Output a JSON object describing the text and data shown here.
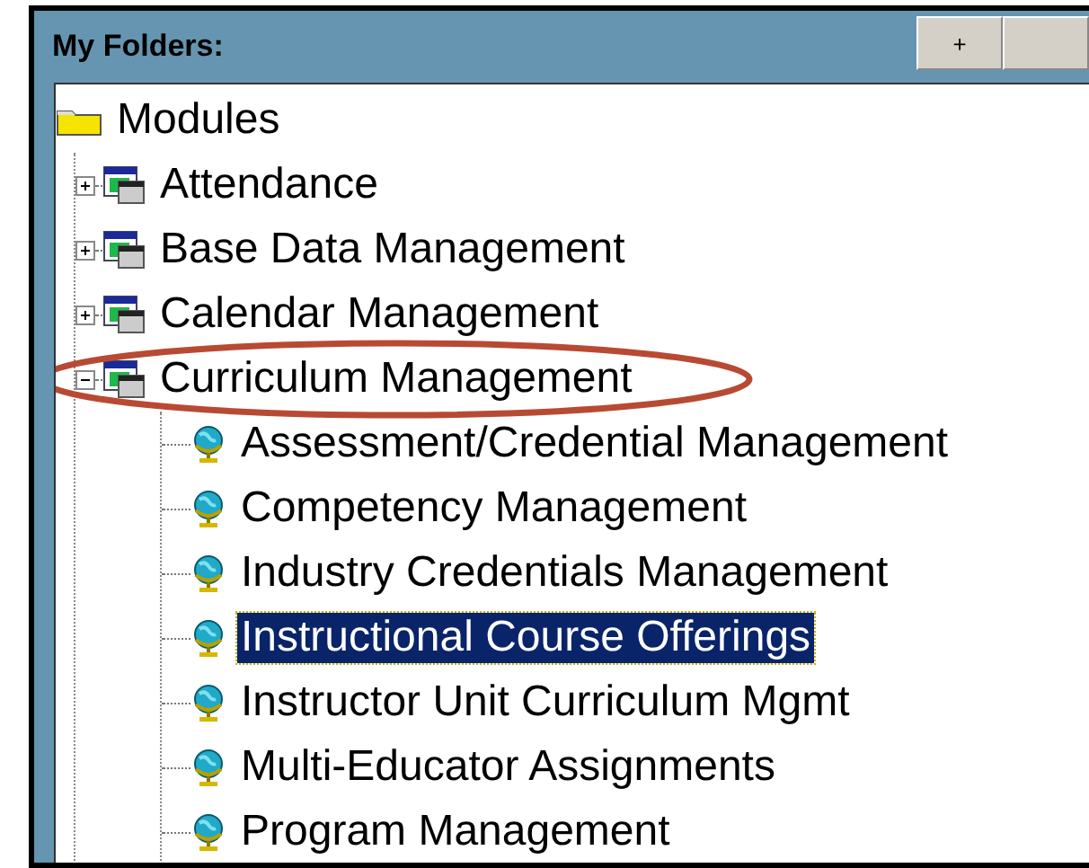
{
  "panel": {
    "title": "My Folders:",
    "buttons": [
      {
        "kind": "label",
        "label": "+"
      },
      {
        "kind": "blank"
      }
    ]
  },
  "tree": [
    {
      "label": "Modules",
      "kind": "folder",
      "selected": false,
      "children": [
        {
          "label": "Attendance",
          "kind": "module",
          "expanded": false,
          "selected": false
        },
        {
          "label": "Base Data Management",
          "kind": "module",
          "expanded": false,
          "selected": false
        },
        {
          "label": "Calendar Management",
          "kind": "module",
          "expanded": false,
          "selected": false
        },
        {
          "label": "Curriculum Management",
          "kind": "module",
          "expanded": true,
          "selected": false,
          "circled": true,
          "children": [
            {
              "label": "Assessment/Credential Management",
              "kind": "item",
              "selected": false
            },
            {
              "label": "Competency Management",
              "kind": "item",
              "selected": false
            },
            {
              "label": "Industry Credentials Management",
              "kind": "item",
              "selected": false
            },
            {
              "label": "Instructional Course Offerings",
              "kind": "item",
              "selected": true
            },
            {
              "label": "Instructor Unit Curriculum Mgmt",
              "kind": "item",
              "selected": false
            },
            {
              "label": "Multi-Educator Assignments",
              "kind": "item",
              "selected": false
            },
            {
              "label": "Program Management",
              "kind": "item",
              "selected": false
            }
          ]
        }
      ]
    }
  ]
}
